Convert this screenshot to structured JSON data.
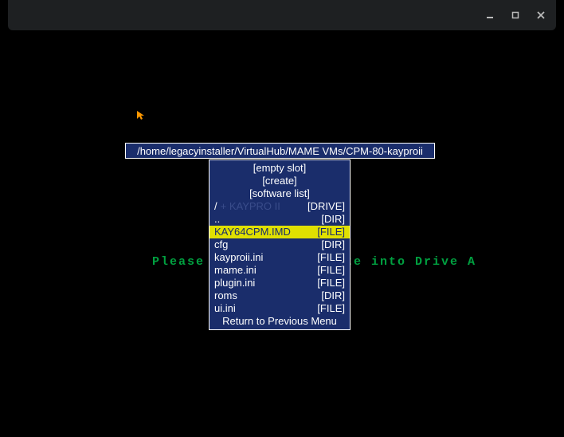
{
  "titlebar": {
    "minimize_tooltip": "Minimize",
    "maximize_tooltip": "Maximize",
    "close_tooltip": "Close"
  },
  "background": {
    "prompt_text": "Please insert a diskette into Drive A",
    "ghost_text": "+   KAYPRO II"
  },
  "path": "/home/legacyinstaller/VirtualHub/MAME VMs/CPM-80-kayproii",
  "menu": {
    "header": [
      "[empty slot]",
      "[create]",
      "[software list]"
    ],
    "entries": [
      {
        "name": "/",
        "type": "[DRIVE]",
        "selected": false,
        "ghost": true
      },
      {
        "name": "..",
        "type": "[DIR]",
        "selected": false
      },
      {
        "name": "KAY64CPM.IMD",
        "type": "[FILE]",
        "selected": true
      },
      {
        "name": "cfg",
        "type": "[DIR]",
        "selected": false
      },
      {
        "name": "kayproii.ini",
        "type": "[FILE]",
        "selected": false
      },
      {
        "name": "mame.ini",
        "type": "[FILE]",
        "selected": false
      },
      {
        "name": "plugin.ini",
        "type": "[FILE]",
        "selected": false
      },
      {
        "name": "roms",
        "type": "[DIR]",
        "selected": false
      },
      {
        "name": "ui.ini",
        "type": "[FILE]",
        "selected": false
      }
    ],
    "footer": "Return to Previous Menu"
  }
}
